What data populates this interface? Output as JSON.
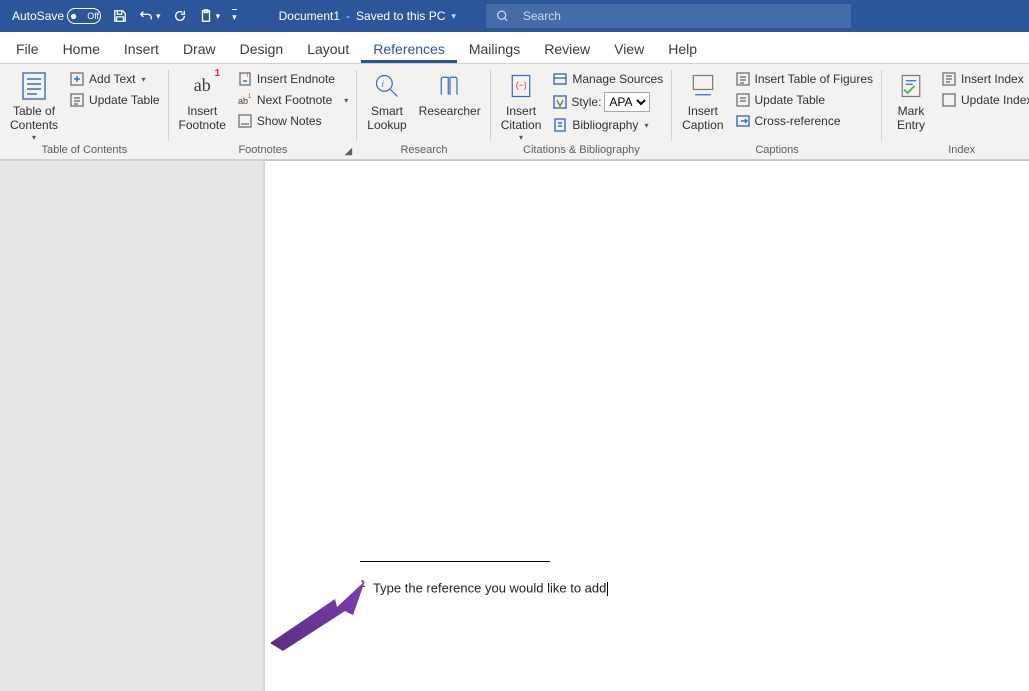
{
  "titlebar": {
    "autosave_label": "AutoSave",
    "autosave_state": "Off",
    "doc_name": "Document1",
    "saved_status": "Saved to this PC",
    "search_placeholder": "Search"
  },
  "tabs": {
    "file": "File",
    "home": "Home",
    "insert": "Insert",
    "draw": "Draw",
    "design": "Design",
    "layout": "Layout",
    "references": "References",
    "mailings": "Mailings",
    "review": "Review",
    "view": "View",
    "help": "Help"
  },
  "ribbon": {
    "toc": {
      "group_label": "Table of Contents",
      "table_of_contents": "Table of\nContents",
      "add_text": "Add Text",
      "update_table": "Update Table"
    },
    "footnotes": {
      "group_label": "Footnotes",
      "insert_footnote": "Insert\nFootnote",
      "insert_endnote": "Insert Endnote",
      "next_footnote": "Next Footnote",
      "show_notes": "Show Notes"
    },
    "research": {
      "group_label": "Research",
      "smart_lookup": "Smart\nLookup",
      "researcher": "Researcher"
    },
    "citations": {
      "group_label": "Citations & Bibliography",
      "insert_citation": "Insert\nCitation",
      "manage_sources": "Manage Sources",
      "style_label": "Style:",
      "style_value": "APA",
      "bibliography": "Bibliography"
    },
    "captions": {
      "group_label": "Captions",
      "insert_caption": "Insert\nCaption",
      "insert_table_of_figures": "Insert Table of Figures",
      "update_table": "Update Table",
      "cross_reference": "Cross-reference"
    },
    "index": {
      "group_label": "Index",
      "mark_entry": "Mark\nEntry",
      "insert_index": "Insert Index",
      "update_index": "Update Index"
    }
  },
  "document": {
    "footnote_number": "1",
    "footnote_text": "Type the reference you would like to add"
  }
}
